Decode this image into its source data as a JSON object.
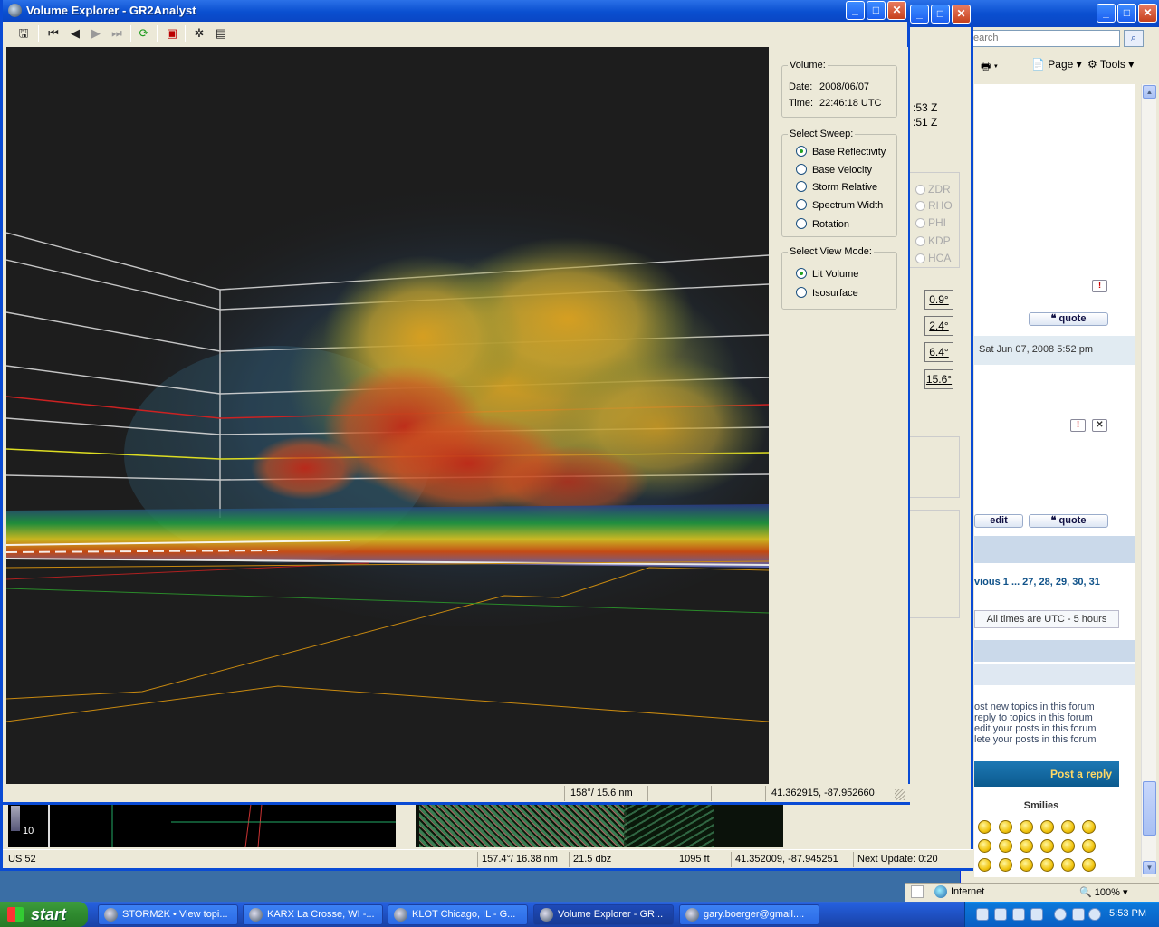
{
  "volume_explorer": {
    "title": "Volume Explorer - GR2Analyst",
    "volume": {
      "legend": "Volume:",
      "date_label": "Date:",
      "date_value": "2008/06/07",
      "time_label": "Time:",
      "time_value": "22:46:18 UTC"
    },
    "sweep": {
      "legend": "Select Sweep:",
      "options": [
        "Base Reflectivity",
        "Base Velocity",
        "Storm Relative",
        "Spectrum Width",
        "Rotation"
      ],
      "selected": "Base Reflectivity"
    },
    "view_mode": {
      "legend": "Select View Mode:",
      "options": [
        "Lit Volume",
        "Isosurface"
      ],
      "selected": "Lit Volume"
    },
    "status": {
      "bearing_range": "158°/ 15.6 nm",
      "coords": "41.362915, -87.952660"
    },
    "toolbar_icons": [
      "save-icon",
      "first-frame-icon",
      "prev-frame-icon",
      "play-icon",
      "last-frame-icon",
      "refresh-icon",
      "volume-icon",
      "settings-icon",
      "chart-icon"
    ]
  },
  "gr2analyst_main": {
    "partial_time_1": ":53 Z",
    "partial_time_2": ":51 Z",
    "dual_pol_options": [
      "ZDR",
      "RHO",
      "PHI",
      "KDP",
      "HCA"
    ],
    "tilts": [
      "0.9°",
      "2.4°",
      "6.4°",
      "15.6°"
    ],
    "colorbar_label": "10",
    "status": {
      "road": "US 52",
      "bearing_range": "157.4°/ 16.38 nm",
      "value": "21.5 dbz",
      "height": "1095 ft",
      "coords": "41.352009, -87.945251",
      "next_update": "Next Update: 0:20"
    }
  },
  "browser": {
    "search_placeholder": "earch",
    "toolbar": {
      "page": "Page",
      "tools": "Tools"
    },
    "post_date": "Sat Jun 07, 2008 5:52 pm",
    "quote_label": "quote",
    "edit_label": "edit",
    "pagination": "vious  1 ... 27, 28, 29, 30, 31",
    "timezone": "All times are UTC - 5 hours",
    "permissions": [
      "ost new topics in this forum",
      " reply to topics in this forum",
      "edit your posts in this forum",
      "lete your posts in this forum"
    ],
    "post_reply": "Post a reply",
    "smilies_title": "Smilies",
    "zone": "Internet",
    "zoom": "100%"
  },
  "taskbar": {
    "start": "start",
    "tasks": [
      "STORM2K • View topi...",
      "KARX La Crosse, WI -...",
      "KLOT Chicago, IL - G...",
      "Volume Explorer - GR...",
      "gary.boerger@gmail...."
    ],
    "active_task": "Volume Explorer - GR...",
    "clock": "5:53 PM"
  }
}
